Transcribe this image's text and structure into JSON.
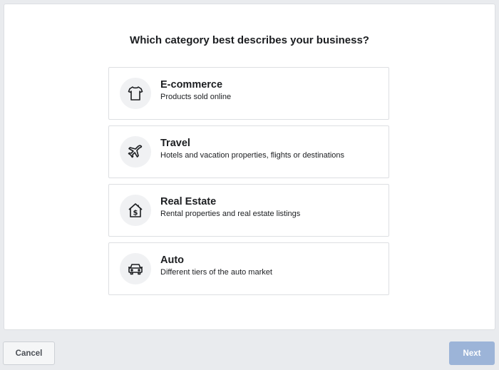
{
  "dialog": {
    "title": "Which category best describes your business?"
  },
  "options": [
    {
      "title": "E-commerce",
      "description": "Products sold online",
      "icon": "tshirt-icon"
    },
    {
      "title": "Travel",
      "description": "Hotels and vacation properties, flights or destinations",
      "icon": "airplane-icon"
    },
    {
      "title": "Real Estate",
      "description": "Rental properties and real estate listings",
      "icon": "house-dollar-icon"
    },
    {
      "title": "Auto",
      "description": "Different tiers of the auto market",
      "icon": "car-icon"
    }
  ],
  "footer": {
    "cancel_label": "Cancel",
    "next_label": "Next"
  },
  "colors": {
    "background": "#e9ebee",
    "next_disabled": "#9cb4d8",
    "icon_circle": "#f0f1f3"
  }
}
